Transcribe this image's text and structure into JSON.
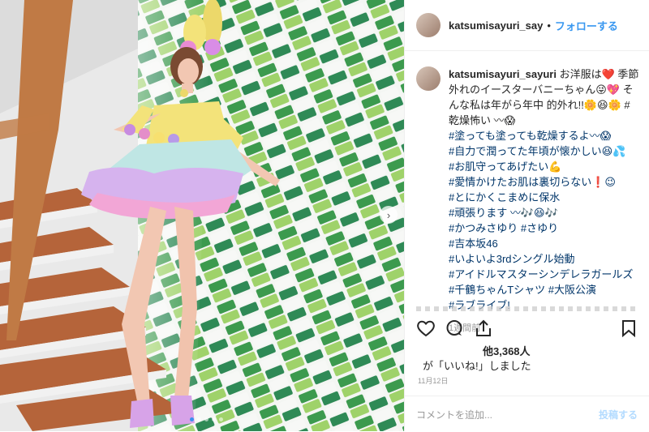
{
  "header": {
    "username": "katsumisayuri_say",
    "separator": "•",
    "follow_label": "フォローする"
  },
  "caption": {
    "username": "katsumisayuri_sayuri",
    "lines": [
      "お洋服は❤️ 季節",
      "外れのイースターバニーちゃん😜💖 そ",
      "んな私は年がら年中 的外れ!!🌼😆🌼 #",
      "乾燥怖い 〰😱",
      "#塗っても塗っても乾燥するよ〰😱",
      "#自力で潤ってた年頃が懐かしい😆💦",
      "#お肌守ってあげたい💪",
      "#愛情かけたお肌は裏切らない❗️😉",
      "#とにかくこまめに保水",
      "#頑張ります 〰🎶😆🎶",
      "#かつみさゆり #さゆり",
      "#吉本坂46",
      "#いよいよ3rdシングル始動",
      "#アイドルマスターシンデレラガールズ",
      "#千鶴ちゃんTシャツ #大阪公演",
      "#ラブライブ!"
    ],
    "time": "1週間前"
  },
  "likes": {
    "count_label": "他3,368人",
    "line": "が「いいね!」しました"
  },
  "date": "11月12日",
  "composer": {
    "placeholder": "コメントを追加...",
    "post_label": "投稿する"
  },
  "carousel": {
    "slides": 5,
    "active_index": 0
  },
  "colors": {
    "accent": "#3897f0",
    "link": "#003569",
    "muted": "#999999",
    "tile_green": "#3c9a4e",
    "tile_light": "#9fd26a"
  },
  "icons": [
    "heart-icon",
    "comment-icon",
    "share-icon",
    "bookmark-icon",
    "chevron-right-icon"
  ]
}
